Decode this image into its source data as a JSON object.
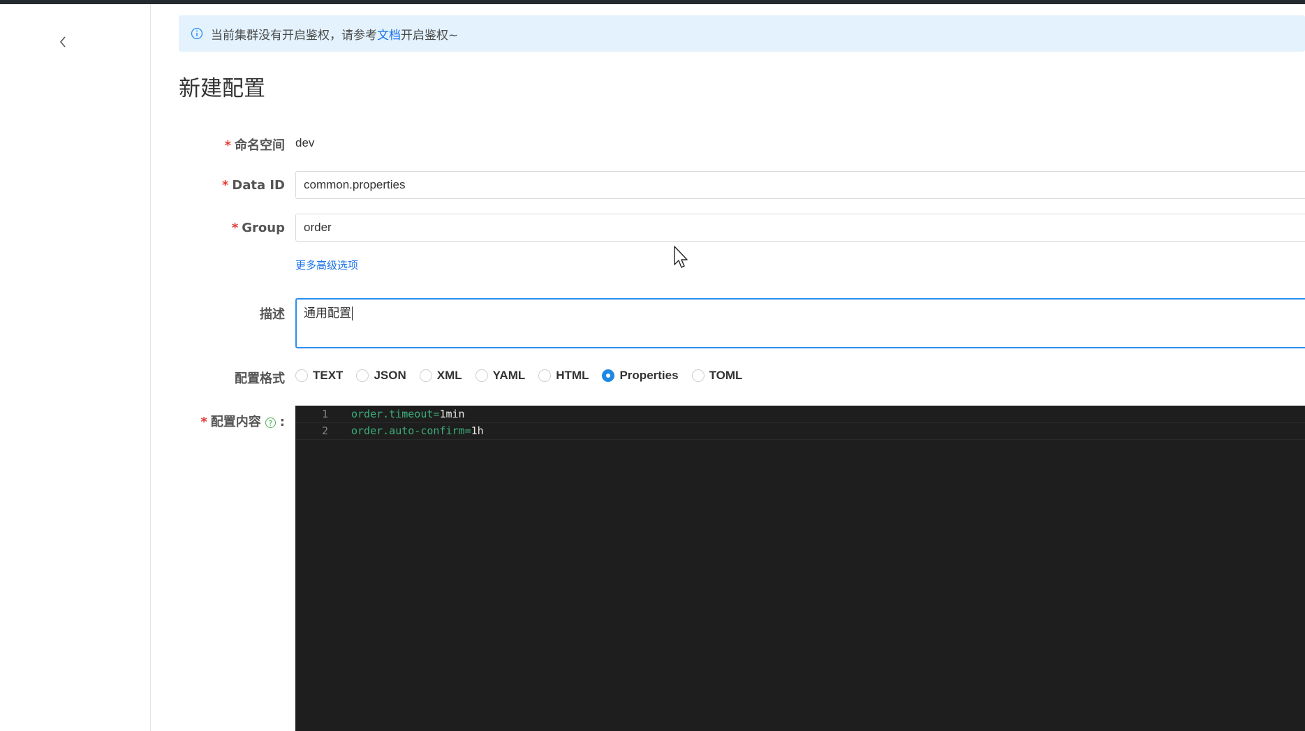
{
  "alert": {
    "text_before": "当前集群没有开启鉴权，请参考",
    "link": "文档",
    "text_after": "开启鉴权~"
  },
  "page_title": "新建配置",
  "form": {
    "namespace": {
      "label": "命名空间",
      "value": "dev"
    },
    "data_id": {
      "label": "Data ID",
      "value": "common.properties"
    },
    "group": {
      "label": "Group",
      "value": "order"
    },
    "more_options": "更多高级选项",
    "description": {
      "label": "描述",
      "value": "通用配置"
    },
    "format": {
      "label": "配置格式",
      "options": [
        "TEXT",
        "JSON",
        "XML",
        "YAML",
        "HTML",
        "Properties",
        "TOML"
      ],
      "selected": "Properties"
    },
    "content": {
      "label": "配置内容",
      "colon": ":",
      "help_icon": "?",
      "lines": [
        {
          "num": "1",
          "key": "order.timeout",
          "eq": "=",
          "value": "1min"
        },
        {
          "num": "2",
          "key": "order.auto-confirm",
          "eq": "=",
          "value": "1h"
        }
      ]
    }
  },
  "icons": {
    "back": "chevron-left-icon",
    "info": "info-icon",
    "help": "question-circle-icon"
  },
  "colors": {
    "accent": "#1e88e5",
    "alert_bg": "#e3f2fd",
    "required": "#e53935",
    "editor_bg": "#1e1e1e"
  }
}
